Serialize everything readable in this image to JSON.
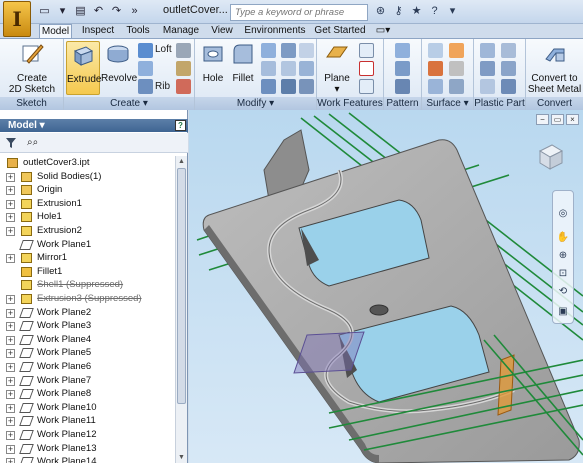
{
  "titlebar": {
    "logo_letter": "I",
    "document_title": "outletCover...",
    "search_placeholder": "Type a keyword or phrase",
    "qat_icons": [
      "new-icon",
      "open-icon",
      "save-icon",
      "undo-icon",
      "redo-icon",
      "more-icon"
    ],
    "right_icons": [
      "binoculars-icon",
      "key-icon",
      "star-icon",
      "help-icon",
      "help-dropdown-icon"
    ]
  },
  "tabs": [
    {
      "label": "Model",
      "active": true
    },
    {
      "label": "Inspect",
      "active": false
    },
    {
      "label": "Tools",
      "active": false
    },
    {
      "label": "Manage",
      "active": false
    },
    {
      "label": "View",
      "active": false
    },
    {
      "label": "Environments",
      "active": false
    },
    {
      "label": "Get Started",
      "active": false
    }
  ],
  "ribbon": {
    "sketch": {
      "title": "Sketch",
      "create_sketch_line1": "Create",
      "create_sketch_line2": "2D Sketch"
    },
    "create": {
      "title": "Create",
      "extrude": "Extrude",
      "revolve": "Revolve",
      "loft": "Loft",
      "rib": "Rib"
    },
    "modify": {
      "title": "Modify",
      "hole": "Hole",
      "fillet": "Fillet"
    },
    "work_features": {
      "title": "Work Features",
      "plane": "Plane"
    },
    "pattern": {
      "title": "Pattern"
    },
    "surface": {
      "title": "Surface"
    },
    "plastic_part": {
      "title": "Plastic Part"
    },
    "convert": {
      "title": "Convert",
      "convert_line1": "Convert to",
      "convert_line2": "Sheet Metal"
    }
  },
  "browser": {
    "header": "Model",
    "help": "?",
    "items": [
      {
        "label": "outletCover3.ipt",
        "type": "part",
        "root": true,
        "expand": "",
        "suppressed": false
      },
      {
        "label": "Solid Bodies(1)",
        "type": "folder",
        "expand": "+",
        "suppressed": false
      },
      {
        "label": "Origin",
        "type": "folder",
        "expand": "+",
        "suppressed": false
      },
      {
        "label": "Extrusion1",
        "type": "feature",
        "expand": "+",
        "suppressed": false
      },
      {
        "label": "Hole1",
        "type": "feature",
        "expand": "+",
        "suppressed": false
      },
      {
        "label": "Extrusion2",
        "type": "feature",
        "expand": "+",
        "suppressed": false
      },
      {
        "label": "Work Plane1",
        "type": "plane",
        "expand": "",
        "suppressed": false
      },
      {
        "label": "Mirror1",
        "type": "feature",
        "expand": "+",
        "suppressed": false
      },
      {
        "label": "Fillet1",
        "type": "fillet",
        "expand": "",
        "suppressed": false
      },
      {
        "label": "Shell1 (Suppressed)",
        "type": "feature",
        "expand": "",
        "suppressed": true
      },
      {
        "label": "Extrusion3 (Suppressed)",
        "type": "feature",
        "expand": "+",
        "suppressed": true
      },
      {
        "label": "Work Plane2",
        "type": "plane",
        "expand": "+",
        "suppressed": false
      },
      {
        "label": "Work Plane3",
        "type": "plane",
        "expand": "+",
        "suppressed": false
      },
      {
        "label": "Work Plane4",
        "type": "plane",
        "expand": "+",
        "suppressed": false
      },
      {
        "label": "Work Plane5",
        "type": "plane",
        "expand": "+",
        "suppressed": false
      },
      {
        "label": "Work Plane6",
        "type": "plane",
        "expand": "+",
        "suppressed": false
      },
      {
        "label": "Work Plane7",
        "type": "plane",
        "expand": "+",
        "suppressed": false
      },
      {
        "label": "Work Plane8",
        "type": "plane",
        "expand": "+",
        "suppressed": false
      },
      {
        "label": "Work Plane10",
        "type": "plane",
        "expand": "+",
        "suppressed": false
      },
      {
        "label": "Work Plane11",
        "type": "plane",
        "expand": "+",
        "suppressed": false
      },
      {
        "label": "Work Plane12",
        "type": "plane",
        "expand": "+",
        "suppressed": false
      },
      {
        "label": "Work Plane13",
        "type": "plane",
        "expand": "+",
        "suppressed": false
      },
      {
        "label": "Work Plane14",
        "type": "plane",
        "expand": "+",
        "suppressed": false
      }
    ]
  },
  "colors": {
    "workplane_green": "#1f8a3a",
    "part_gray": "#a6a6a6",
    "viewport_top": "#b9d8ef",
    "active_button": "#f5c94e"
  }
}
